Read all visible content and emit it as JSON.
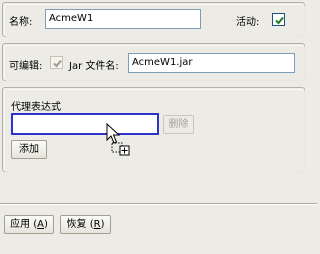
{
  "general": {
    "name_label": "名称:",
    "name_value": "AcmeW1",
    "active_label": "活动:",
    "active_checked": true
  },
  "jar": {
    "editable_label": "可编辑:",
    "editable_checked": true,
    "jar_name_label": "Jar 文件名:",
    "jar_name_value": "AcmeW1.jar"
  },
  "proxy": {
    "title": "代理表达式",
    "input_value": "",
    "delete_label": "删除",
    "add_label": "添加"
  },
  "footer": {
    "apply_label": "应用",
    "apply_mnemonic": "A",
    "restore_label": "恢复",
    "restore_mnemonic": "R"
  },
  "icons": {
    "cursor": "arrow-cursor-copy-icon"
  }
}
